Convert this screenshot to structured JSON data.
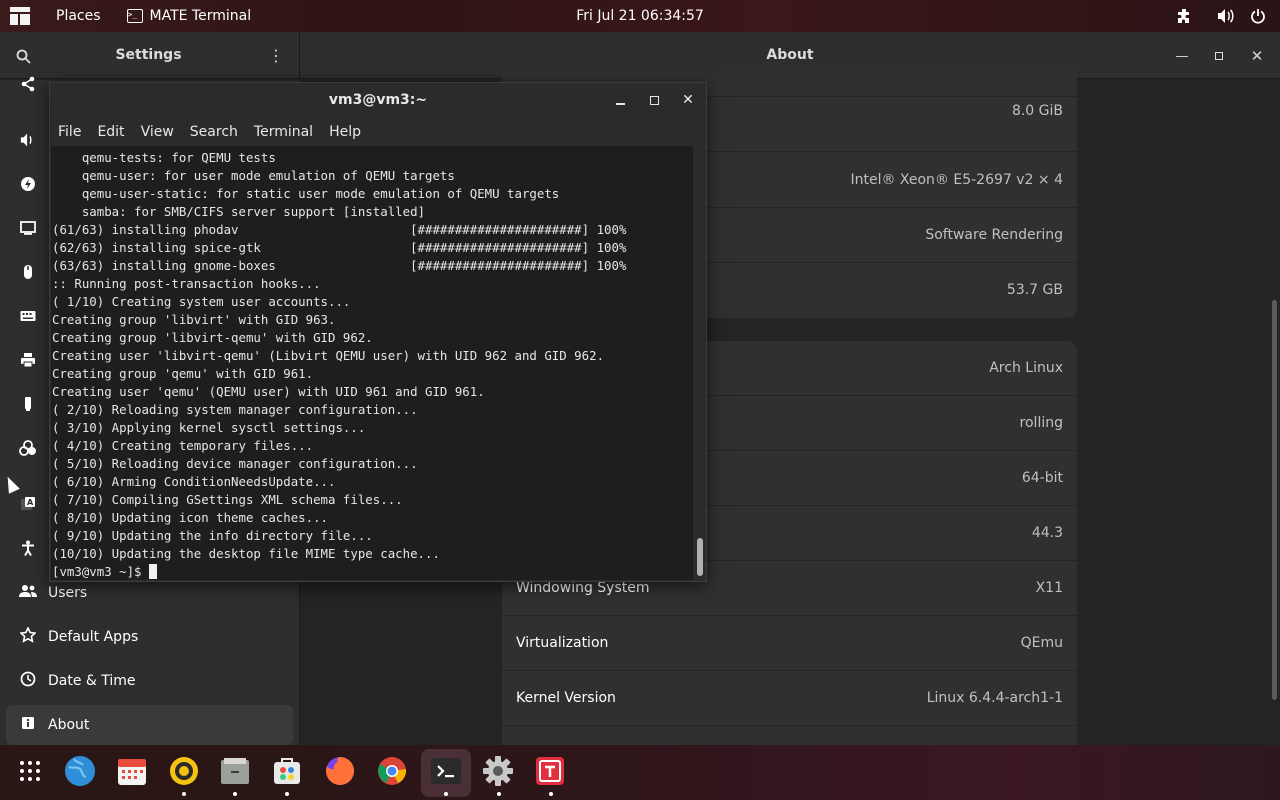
{
  "top_panel": {
    "places_label": "Places",
    "active_app_label": "MATE Terminal",
    "clock": "Fri Jul 21  06:34:57",
    "icons": [
      "apps-menu-icon",
      "terminal-app-icon",
      "extension-icon",
      "volume-icon",
      "power-icon"
    ]
  },
  "settings": {
    "title": "Settings",
    "page_title": "About",
    "sidebar": {
      "users_label": "Users",
      "default_apps_label": "Default Apps",
      "date_time_label": "Date & Time",
      "about_label": "About",
      "icons": [
        "share-icon",
        "sound-icon",
        "power-icon",
        "display-icon",
        "mouse-icon",
        "keyboard-icon",
        "printer-icon",
        "removable-media-icon",
        "color-icon",
        "region-icon",
        "accessibility-icon",
        "users-icon",
        "default-apps-icon",
        "clock-icon",
        "info-icon"
      ]
    },
    "hardware_values": {
      "memory": "8.0 GiB",
      "processor": "Intel® Xeon® E5-2697 v2 × 4",
      "graphics": "Software Rendering",
      "disk": "53.7 GB"
    },
    "system_rows": [
      {
        "label": "",
        "value": "Arch Linux"
      },
      {
        "label": "",
        "value": "rolling"
      },
      {
        "label": "",
        "value": "64-bit"
      },
      {
        "label": "",
        "value": "44.3"
      },
      {
        "label": "Windowing System",
        "value": "X11"
      },
      {
        "label": "Virtualization",
        "value": "QEmu"
      },
      {
        "label": "Kernel Version",
        "value": "Linux 6.4.4-arch1-1"
      }
    ]
  },
  "terminal": {
    "title": "vm3@vm3:~",
    "menu": {
      "file": "File",
      "edit": "Edit",
      "view": "View",
      "search": "Search",
      "terminal": "Terminal",
      "help": "Help"
    },
    "lines": [
      "    qemu-tests: for QEMU tests",
      "    qemu-user: for user mode emulation of QEMU targets",
      "    qemu-user-static: for static user mode emulation of QEMU targets",
      "    samba: for SMB/CIFS server support [installed]",
      "(61/63) installing phodav                       [######################] 100%",
      "(62/63) installing spice-gtk                    [######################] 100%",
      "(63/63) installing gnome-boxes                  [######################] 100%",
      ":: Running post-transaction hooks...",
      "( 1/10) Creating system user accounts...",
      "Creating group 'libvirt' with GID 963.",
      "Creating group 'libvirt-qemu' with GID 962.",
      "Creating user 'libvirt-qemu' (Libvirt QEMU user) with UID 962 and GID 962.",
      "Creating group 'qemu' with GID 961.",
      "Creating user 'qemu' (QEMU user) with UID 961 and GID 961.",
      "( 2/10) Reloading system manager configuration...",
      "( 3/10) Applying kernel sysctl settings...",
      "( 4/10) Creating temporary files...",
      "( 5/10) Reloading device manager configuration...",
      "( 6/10) Arming ConditionNeedsUpdate...",
      "( 7/10) Compiling GSettings XML schema files...",
      "( 8/10) Updating icon theme caches...",
      "( 9/10) Updating the info directory file...",
      "(10/10) Updating the desktop file MIME type cache..."
    ],
    "prompt": "[vm3@vm3 ~]$ "
  },
  "dock": {
    "items": [
      "app-grid-icon",
      "web-browser-icon",
      "calendar-icon",
      "rhythmbox-icon",
      "files-icon",
      "software-icon",
      "firefox-icon",
      "chrome-icon",
      "terminal-icon",
      "settings-icon",
      "typora-icon"
    ]
  },
  "colors": {
    "panel": "#2f1415",
    "window_bg": "#242424",
    "card_bg": "#303030",
    "terminal_bg": "#1e1e1e"
  }
}
